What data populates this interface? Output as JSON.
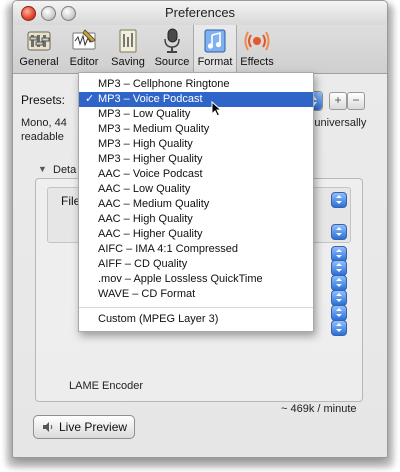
{
  "window": {
    "title": "Preferences"
  },
  "toolbar": {
    "items": [
      {
        "label": "General",
        "icon": "general-icon"
      },
      {
        "label": "Editor",
        "icon": "editor-icon"
      },
      {
        "label": "Saving",
        "icon": "saving-icon"
      },
      {
        "label": "Source",
        "icon": "microphone-icon"
      },
      {
        "label": "Format",
        "icon": "format-icon"
      },
      {
        "label": "Effects",
        "icon": "effects-icon"
      }
    ],
    "active_index": 4
  },
  "presets": {
    "label": "Presets:",
    "add": "+",
    "remove": "−"
  },
  "description": {
    "line1_start": "Mono, 44",
    "line1_end": "and universally",
    "line2_start": "readable"
  },
  "details": {
    "label": "Deta",
    "file_label": "File",
    "encoder": "LAME Encoder",
    "bitrate": "~ 469k / minute"
  },
  "live_preview": {
    "label": "Live Preview"
  },
  "menu": {
    "items": [
      "MP3 – Cellphone Ringtone",
      "MP3 – Voice Podcast",
      "MP3 – Low Quality",
      "MP3 – Medium Quality",
      "MP3 – High Quality",
      "MP3 – Higher Quality",
      "AAC – Voice Podcast",
      "AAC – Low Quality",
      "AAC – Medium Quality",
      "AAC – High Quality",
      "AAC – Higher Quality",
      "AIFC – IMA 4:1 Compressed",
      "AIFF – CD Quality",
      ".mov – Apple Lossless QuickTime",
      "WAVE – CD Format"
    ],
    "selected": "MP3 – Voice Podcast",
    "check": "✓",
    "custom": "Custom (MPEG Layer 3)"
  },
  "colors": {
    "selection": "#2f64c8",
    "popup_arrows": "#2a6fd8"
  }
}
